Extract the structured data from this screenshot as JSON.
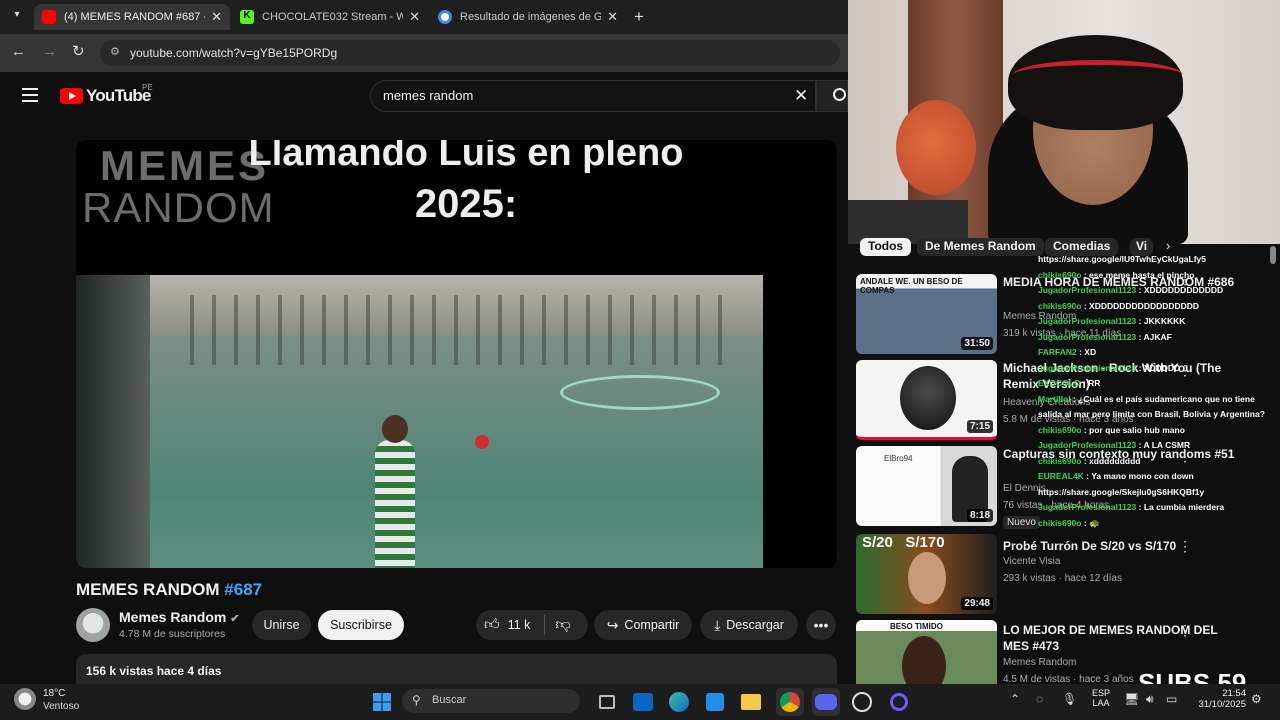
{
  "browser": {
    "tabs": [
      {
        "title": "(4) MEMES RANDOM #687 - Yo",
        "color": "#ff0000",
        "active": true
      },
      {
        "title": "CHOCOLATE032 Stream - Watc",
        "color": "#53fc18",
        "active": false
      },
      {
        "title": "Resultado de imágenes de Goo",
        "color": "#4285f4",
        "active": false
      }
    ],
    "url": "youtube.com/watch?v=gYBe15PORDg"
  },
  "youtube": {
    "logo": "YouTube",
    "region": "PE",
    "search_value": "memes random",
    "video": {
      "watermark_line1": "MEMES",
      "watermark_line2": "RANDOM",
      "caption_line1": "Llamando Luis en pleno",
      "caption_line2": "2025:"
    },
    "title_prefix": "MEMES RANDOM ",
    "title_tag": "#687",
    "channel": {
      "name": "Memes Random",
      "subs": "4.78 M de suscriptores"
    },
    "join_label": "Unirse",
    "subscribe_label": "Suscribirse",
    "likes": "11 k",
    "share_label": "Compartir",
    "download_label": "Descargar",
    "desc_meta": "156 k vistas  hace 4 días",
    "chips": [
      "Todos",
      "De Memes Random",
      "Comedias",
      "Vi"
    ],
    "related": [
      {
        "title": "MEDIA HORA DE MEMES RANDOM #686",
        "channel": "Memes Random",
        "meta": "319 k vistas · hace 11 días",
        "duration": "31:50",
        "thumb_text": "ANDALE WE.  UN BESO DE COMPAS",
        "badge": ""
      },
      {
        "title": "Michael Jackson - Rock With You (The Remix Version)",
        "channel": "Heavenly Creations",
        "meta": "5.8 M de vistas · hace 3 años",
        "duration": "7:15",
        "thumb_text": "",
        "badge": ""
      },
      {
        "title": "Capturas sin contexto muy randoms #51",
        "channel": "El Dennis",
        "meta": "76 vistas · hace 4 horas",
        "duration": "8:18",
        "thumb_text": "ElBro94",
        "badge": "Nuevo"
      },
      {
        "title": "Probé Turrón De S/20 vs S/170",
        "channel": "Vicente Visia",
        "meta": "293 k vistas · hace 12 días",
        "duration": "29:48",
        "thumb_text": "S/20   S/170",
        "badge": ""
      },
      {
        "title": "LO MEJOR DE MEMES RANDOM DEL MES #473",
        "channel": "Memes Random",
        "meta": "4.5 M de vistas · hace 3 años",
        "duration": "",
        "thumb_text": "BESO TIMIDO",
        "badge": ""
      }
    ]
  },
  "chat": [
    {
      "u": "",
      "m": "https://share.google/lU9TwhEyCkUgaLfy5"
    },
    {
      "u": "chikis690o",
      "m": " : ese meme hasta el pincho"
    },
    {
      "u": "JugadorProfesional1123",
      "m": " : XDDDDDDDDDDDD"
    },
    {
      "u": "chikis690o",
      "m": " : XDDDDDDDDDDDDDDDDD"
    },
    {
      "u": "JugadorProfesional1123",
      "m": " : JKKKKKK"
    },
    {
      "u": "JugadorProfesional1123",
      "m": " : AJKAF"
    },
    {
      "u": "FARFAN2",
      "m": " : XD"
    },
    {
      "u": "JugadorProfesional1123",
      "m": " : XDDDDD"
    },
    {
      "u": "EXOCOLO",
      "m": " : RR"
    },
    {
      "u": "MartilloI",
      "m": " : ¿Cuál es el país sudamericano que no tiene salida al mar pero limita con Brasil, Bolivia y Argentina?"
    },
    {
      "u": "chikis690o",
      "m": " : por que salio hub mano"
    },
    {
      "u": "JugadorProfesional1123",
      "m": " : A LA CSMR"
    },
    {
      "u": "chikis690o",
      "m": " : xddddddddd"
    },
    {
      "u": "EUREAL4K",
      "m": " : Ya mano mono con down"
    },
    {
      "u": "",
      "m": "https://share.google/Skejlu0gS6HKQBf1y"
    },
    {
      "u": "JugadorProfesional1123",
      "m": " : La cumbia mierdera"
    },
    {
      "u": "chikis690o",
      "m": " : 🐢"
    }
  ],
  "subs_overlay": "SUBS 59",
  "taskbar": {
    "weather_temp": "18°C",
    "weather_desc": "Ventoso",
    "search_label": "Buscar",
    "lang1": "ESP",
    "lang2": "LAA",
    "time": "21:54",
    "date": "31/10/2025"
  }
}
